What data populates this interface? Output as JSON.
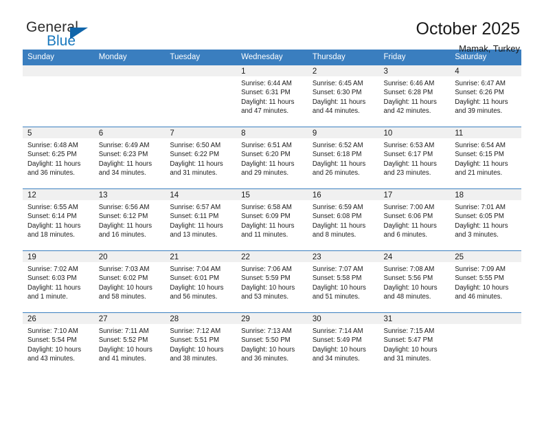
{
  "brand": {
    "name_top": "General",
    "name_bottom": "Blue",
    "triangle_color": "#1065aa",
    "blue_text_color": "#1878be"
  },
  "header": {
    "title": "October 2025",
    "subtitle": "Mamak, Turkey"
  },
  "theme": {
    "header_bar_color": "#3a7ebf",
    "daynum_band_color": "#f0f0f0",
    "text_color": "#1a1a1a"
  },
  "calendar": {
    "weekday_headers": [
      "Sunday",
      "Monday",
      "Tuesday",
      "Wednesday",
      "Thursday",
      "Friday",
      "Saturday"
    ],
    "weeks": [
      [
        {
          "day": "",
          "empty": true,
          "sunrise": "",
          "sunset": "",
          "daylight_line1": "",
          "daylight_line2": ""
        },
        {
          "day": "",
          "empty": true,
          "sunrise": "",
          "sunset": "",
          "daylight_line1": "",
          "daylight_line2": ""
        },
        {
          "day": "",
          "empty": true,
          "sunrise": "",
          "sunset": "",
          "daylight_line1": "",
          "daylight_line2": ""
        },
        {
          "day": "1",
          "empty": false,
          "sunrise": "Sunrise: 6:44 AM",
          "sunset": "Sunset: 6:31 PM",
          "daylight_line1": "Daylight: 11 hours",
          "daylight_line2": "and 47 minutes."
        },
        {
          "day": "2",
          "empty": false,
          "sunrise": "Sunrise: 6:45 AM",
          "sunset": "Sunset: 6:30 PM",
          "daylight_line1": "Daylight: 11 hours",
          "daylight_line2": "and 44 minutes."
        },
        {
          "day": "3",
          "empty": false,
          "sunrise": "Sunrise: 6:46 AM",
          "sunset": "Sunset: 6:28 PM",
          "daylight_line1": "Daylight: 11 hours",
          "daylight_line2": "and 42 minutes."
        },
        {
          "day": "4",
          "empty": false,
          "sunrise": "Sunrise: 6:47 AM",
          "sunset": "Sunset: 6:26 PM",
          "daylight_line1": "Daylight: 11 hours",
          "daylight_line2": "and 39 minutes."
        }
      ],
      [
        {
          "day": "5",
          "empty": false,
          "sunrise": "Sunrise: 6:48 AM",
          "sunset": "Sunset: 6:25 PM",
          "daylight_line1": "Daylight: 11 hours",
          "daylight_line2": "and 36 minutes."
        },
        {
          "day": "6",
          "empty": false,
          "sunrise": "Sunrise: 6:49 AM",
          "sunset": "Sunset: 6:23 PM",
          "daylight_line1": "Daylight: 11 hours",
          "daylight_line2": "and 34 minutes."
        },
        {
          "day": "7",
          "empty": false,
          "sunrise": "Sunrise: 6:50 AM",
          "sunset": "Sunset: 6:22 PM",
          "daylight_line1": "Daylight: 11 hours",
          "daylight_line2": "and 31 minutes."
        },
        {
          "day": "8",
          "empty": false,
          "sunrise": "Sunrise: 6:51 AM",
          "sunset": "Sunset: 6:20 PM",
          "daylight_line1": "Daylight: 11 hours",
          "daylight_line2": "and 29 minutes."
        },
        {
          "day": "9",
          "empty": false,
          "sunrise": "Sunrise: 6:52 AM",
          "sunset": "Sunset: 6:18 PM",
          "daylight_line1": "Daylight: 11 hours",
          "daylight_line2": "and 26 minutes."
        },
        {
          "day": "10",
          "empty": false,
          "sunrise": "Sunrise: 6:53 AM",
          "sunset": "Sunset: 6:17 PM",
          "daylight_line1": "Daylight: 11 hours",
          "daylight_line2": "and 23 minutes."
        },
        {
          "day": "11",
          "empty": false,
          "sunrise": "Sunrise: 6:54 AM",
          "sunset": "Sunset: 6:15 PM",
          "daylight_line1": "Daylight: 11 hours",
          "daylight_line2": "and 21 minutes."
        }
      ],
      [
        {
          "day": "12",
          "empty": false,
          "sunrise": "Sunrise: 6:55 AM",
          "sunset": "Sunset: 6:14 PM",
          "daylight_line1": "Daylight: 11 hours",
          "daylight_line2": "and 18 minutes."
        },
        {
          "day": "13",
          "empty": false,
          "sunrise": "Sunrise: 6:56 AM",
          "sunset": "Sunset: 6:12 PM",
          "daylight_line1": "Daylight: 11 hours",
          "daylight_line2": "and 16 minutes."
        },
        {
          "day": "14",
          "empty": false,
          "sunrise": "Sunrise: 6:57 AM",
          "sunset": "Sunset: 6:11 PM",
          "daylight_line1": "Daylight: 11 hours",
          "daylight_line2": "and 13 minutes."
        },
        {
          "day": "15",
          "empty": false,
          "sunrise": "Sunrise: 6:58 AM",
          "sunset": "Sunset: 6:09 PM",
          "daylight_line1": "Daylight: 11 hours",
          "daylight_line2": "and 11 minutes."
        },
        {
          "day": "16",
          "empty": false,
          "sunrise": "Sunrise: 6:59 AM",
          "sunset": "Sunset: 6:08 PM",
          "daylight_line1": "Daylight: 11 hours",
          "daylight_line2": "and 8 minutes."
        },
        {
          "day": "17",
          "empty": false,
          "sunrise": "Sunrise: 7:00 AM",
          "sunset": "Sunset: 6:06 PM",
          "daylight_line1": "Daylight: 11 hours",
          "daylight_line2": "and 6 minutes."
        },
        {
          "day": "18",
          "empty": false,
          "sunrise": "Sunrise: 7:01 AM",
          "sunset": "Sunset: 6:05 PM",
          "daylight_line1": "Daylight: 11 hours",
          "daylight_line2": "and 3 minutes."
        }
      ],
      [
        {
          "day": "19",
          "empty": false,
          "sunrise": "Sunrise: 7:02 AM",
          "sunset": "Sunset: 6:03 PM",
          "daylight_line1": "Daylight: 11 hours",
          "daylight_line2": "and 1 minute."
        },
        {
          "day": "20",
          "empty": false,
          "sunrise": "Sunrise: 7:03 AM",
          "sunset": "Sunset: 6:02 PM",
          "daylight_line1": "Daylight: 10 hours",
          "daylight_line2": "and 58 minutes."
        },
        {
          "day": "21",
          "empty": false,
          "sunrise": "Sunrise: 7:04 AM",
          "sunset": "Sunset: 6:01 PM",
          "daylight_line1": "Daylight: 10 hours",
          "daylight_line2": "and 56 minutes."
        },
        {
          "day": "22",
          "empty": false,
          "sunrise": "Sunrise: 7:06 AM",
          "sunset": "Sunset: 5:59 PM",
          "daylight_line1": "Daylight: 10 hours",
          "daylight_line2": "and 53 minutes."
        },
        {
          "day": "23",
          "empty": false,
          "sunrise": "Sunrise: 7:07 AM",
          "sunset": "Sunset: 5:58 PM",
          "daylight_line1": "Daylight: 10 hours",
          "daylight_line2": "and 51 minutes."
        },
        {
          "day": "24",
          "empty": false,
          "sunrise": "Sunrise: 7:08 AM",
          "sunset": "Sunset: 5:56 PM",
          "daylight_line1": "Daylight: 10 hours",
          "daylight_line2": "and 48 minutes."
        },
        {
          "day": "25",
          "empty": false,
          "sunrise": "Sunrise: 7:09 AM",
          "sunset": "Sunset: 5:55 PM",
          "daylight_line1": "Daylight: 10 hours",
          "daylight_line2": "and 46 minutes."
        }
      ],
      [
        {
          "day": "26",
          "empty": false,
          "sunrise": "Sunrise: 7:10 AM",
          "sunset": "Sunset: 5:54 PM",
          "daylight_line1": "Daylight: 10 hours",
          "daylight_line2": "and 43 minutes."
        },
        {
          "day": "27",
          "empty": false,
          "sunrise": "Sunrise: 7:11 AM",
          "sunset": "Sunset: 5:52 PM",
          "daylight_line1": "Daylight: 10 hours",
          "daylight_line2": "and 41 minutes."
        },
        {
          "day": "28",
          "empty": false,
          "sunrise": "Sunrise: 7:12 AM",
          "sunset": "Sunset: 5:51 PM",
          "daylight_line1": "Daylight: 10 hours",
          "daylight_line2": "and 38 minutes."
        },
        {
          "day": "29",
          "empty": false,
          "sunrise": "Sunrise: 7:13 AM",
          "sunset": "Sunset: 5:50 PM",
          "daylight_line1": "Daylight: 10 hours",
          "daylight_line2": "and 36 minutes."
        },
        {
          "day": "30",
          "empty": false,
          "sunrise": "Sunrise: 7:14 AM",
          "sunset": "Sunset: 5:49 PM",
          "daylight_line1": "Daylight: 10 hours",
          "daylight_line2": "and 34 minutes."
        },
        {
          "day": "31",
          "empty": false,
          "sunrise": "Sunrise: 7:15 AM",
          "sunset": "Sunset: 5:47 PM",
          "daylight_line1": "Daylight: 10 hours",
          "daylight_line2": "and 31 minutes."
        },
        {
          "day": "",
          "empty": true,
          "sunrise": "",
          "sunset": "",
          "daylight_line1": "",
          "daylight_line2": ""
        }
      ]
    ]
  }
}
